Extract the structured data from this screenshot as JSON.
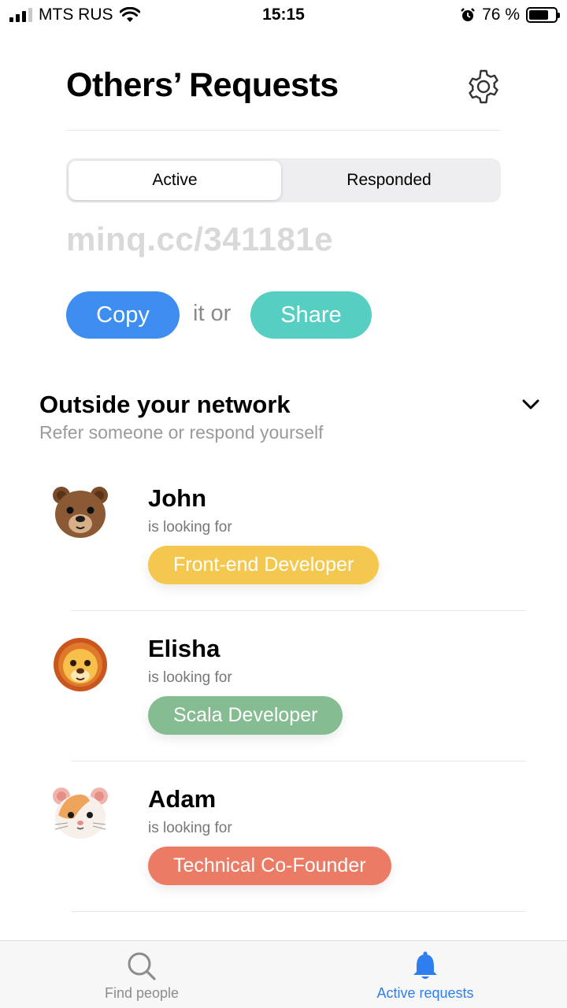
{
  "status_bar": {
    "carrier": "MTS RUS",
    "time": "15:15",
    "battery": "76 %",
    "battery_level": 0.76
  },
  "header": {
    "title": "Others’ Requests",
    "settings_icon": "gear-icon"
  },
  "segment": {
    "active_label": "Active",
    "responded_label": "Responded",
    "selected": "Active"
  },
  "link": {
    "url": "minq.cc/341181e"
  },
  "actions": {
    "copy_label": "Copy",
    "connector": "it or",
    "share_label": "Share",
    "copy_color": "#3d8ef0",
    "share_color": "#56cfc2"
  },
  "section": {
    "title": "Outside your network",
    "subtitle": "Refer someone or respond yourself"
  },
  "requests": [
    {
      "name": "John",
      "looking_text": "is looking for",
      "role": "Front-end Developer",
      "color": "#f4c84e",
      "avatar": "bear-icon"
    },
    {
      "name": "Elisha",
      "looking_text": "is looking for",
      "role": "Scala Developer",
      "color": "#86bc92",
      "avatar": "lion-icon"
    },
    {
      "name": "Adam",
      "looking_text": "is looking for",
      "role": "Technical Co-Founder",
      "color": "#ec7b66",
      "avatar": "hamster-icon"
    }
  ],
  "tabbar": {
    "find_label": "Find people",
    "active_label": "Active requests",
    "active_color": "#2f7ef0"
  }
}
